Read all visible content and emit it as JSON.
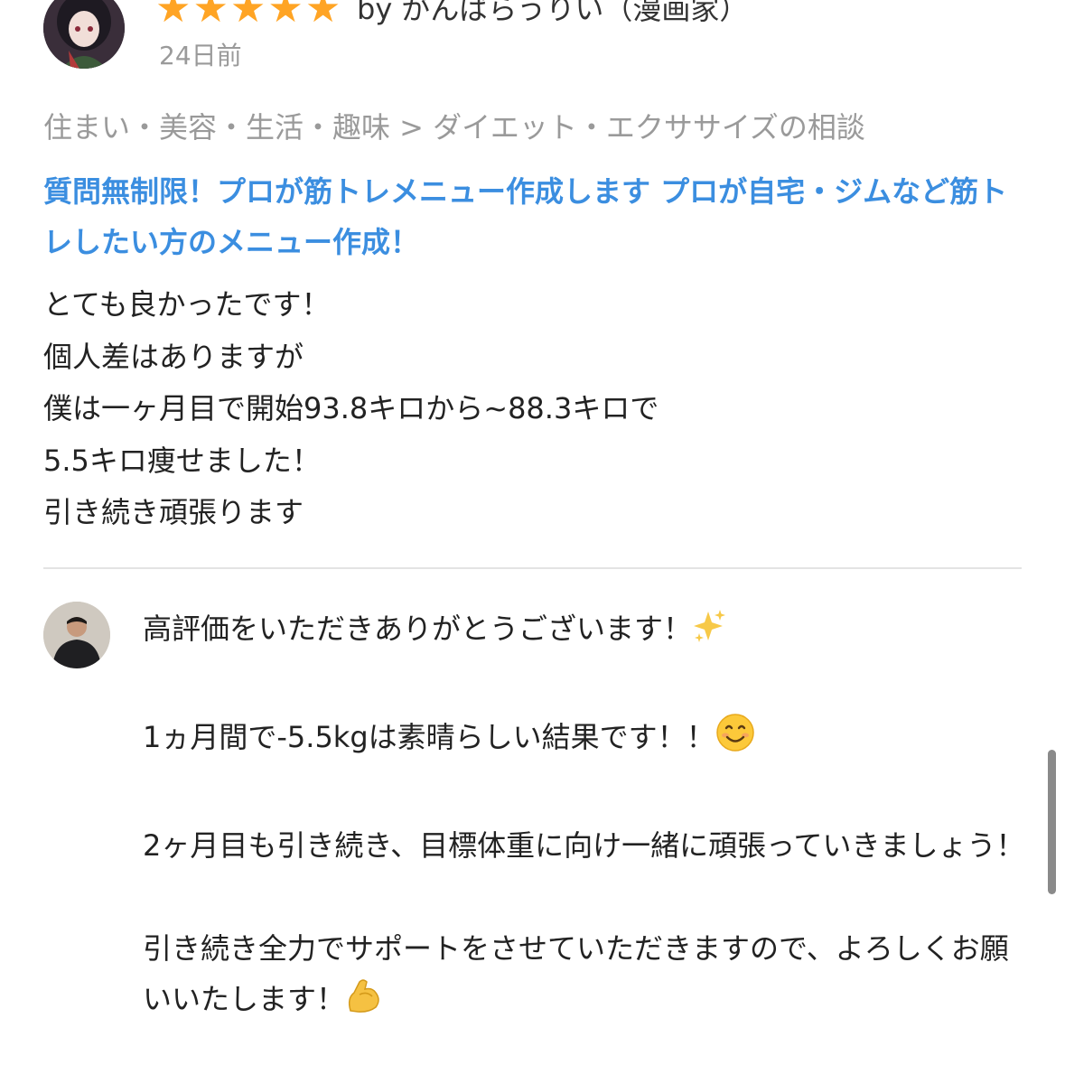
{
  "review": {
    "rating": 5,
    "reviewer": "by がんばらうりい（漫画家）",
    "date": "24日前",
    "breadcrumb": "住まい・美容・生活・趣味 > ダイエット・エクササイズの相談",
    "service_title": "質問無制限！プロが筋トレメニュー作成します プロが自宅・ジムなど筋トレしたい方のメニュー作成！",
    "body_lines": [
      "とても良かったです！",
      "個人差はありますが",
      "僕は一ヶ月目で開始93.8キロから~88.3キロで",
      "5.5キロ痩せました！",
      "引き続き頑張ります"
    ]
  },
  "reply": {
    "para1": "高評価をいただきありがとうございます！",
    "para2": "1ヵ月間で-5.5kgは素晴らしい結果です！！",
    "para3": "2ヶ月目も引き続き、目標体重に向け一緒に頑張っていきましょう！",
    "para4": "引き続き全力でサポートをさせていただきますので、よろしくお願いいたします！"
  },
  "colors": {
    "star": "#ffa424",
    "link": "#3b8ee0",
    "muted": "#9a9a9a"
  },
  "icons": [
    "star-icon",
    "sparkles-emoji",
    "smiling-face-emoji",
    "flexed-biceps-emoji"
  ]
}
